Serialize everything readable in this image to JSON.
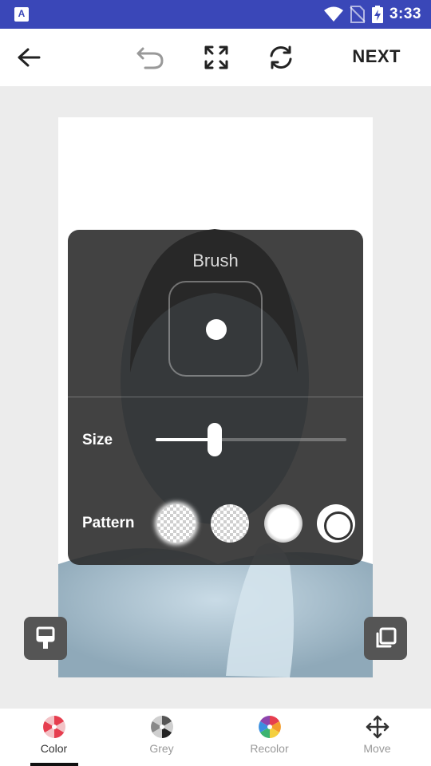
{
  "status_bar": {
    "time": "3:33",
    "app_badge": "A"
  },
  "toolbar": {
    "next_label": "NEXT"
  },
  "brush_panel": {
    "title": "Brush",
    "size_label": "Size",
    "size_value": 0.31,
    "pattern_label": "Pattern",
    "patterns": [
      {
        "name": "soft-checker"
      },
      {
        "name": "checker"
      },
      {
        "name": "glow"
      },
      {
        "name": "ring",
        "selected": true
      }
    ]
  },
  "bottom_nav": {
    "items": [
      {
        "label": "Color",
        "active": true
      },
      {
        "label": "Grey",
        "active": false
      },
      {
        "label": "Recolor",
        "active": false
      },
      {
        "label": "Move",
        "active": false
      }
    ]
  },
  "colors": {
    "status_bar": "#3a47b8",
    "panel": "#282828",
    "tint": "#a9c3d2"
  }
}
